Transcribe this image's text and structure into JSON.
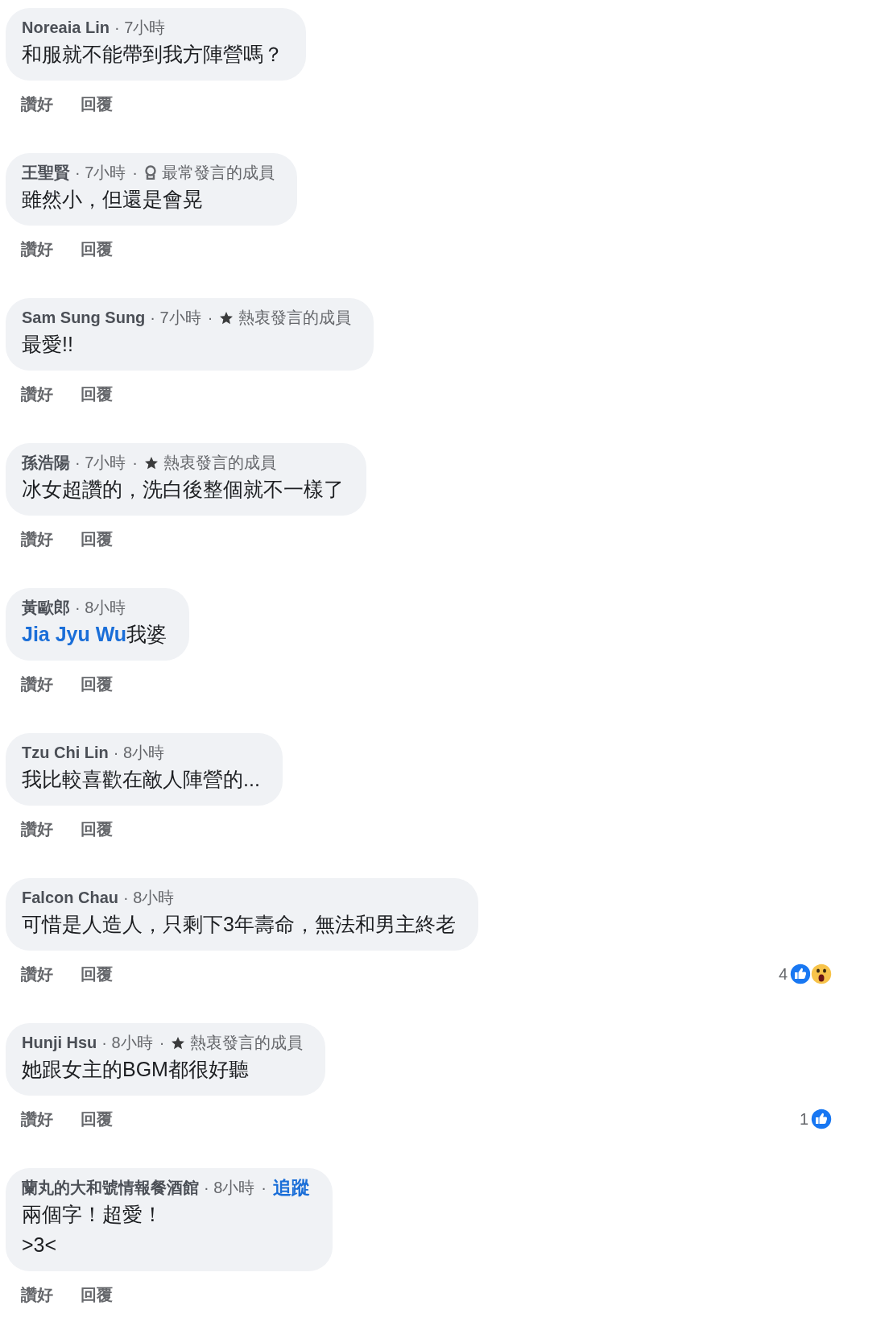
{
  "comments": [
    {
      "author": "Noreaia Lin",
      "time": "· 7小時",
      "body": [
        {
          "kind": "text",
          "text": "和服就不能帶到我方陣營嗎？"
        }
      ],
      "actions": [
        "讚好",
        "回覆"
      ]
    },
    {
      "author": "王聖賢",
      "time": "· 7小時",
      "separator": "·",
      "badge": {
        "kind": "top",
        "label": "最常發言的成員"
      },
      "body": [
        {
          "kind": "text",
          "text": "雖然小，但還是會晃"
        }
      ],
      "actions": [
        "讚好",
        "回覆"
      ]
    },
    {
      "author": "Sam Sung Sung",
      "time": "· 7小時",
      "separator": "·",
      "badge": {
        "kind": "star",
        "label": "熱衷發言的成員"
      },
      "body": [
        {
          "kind": "text",
          "text": "最愛!!"
        }
      ],
      "actions": [
        "讚好",
        "回覆"
      ]
    },
    {
      "author": "孫浩陽",
      "time": "· 7小時",
      "separator": "·",
      "badge": {
        "kind": "star",
        "label": "熱衷發言的成員"
      },
      "body": [
        {
          "kind": "text",
          "text": "冰女超讚的，洗白後整個就不一樣了"
        }
      ],
      "actions": [
        "讚好",
        "回覆"
      ]
    },
    {
      "author": "黃歐郎",
      "time": "· 8小時",
      "body": [
        {
          "kind": "mention",
          "text": "Jia Jyu Wu"
        },
        {
          "kind": "text",
          "text": "我婆"
        }
      ],
      "actions": [
        "讚好",
        "回覆"
      ]
    },
    {
      "author": "Tzu Chi Lin",
      "time": "· 8小時",
      "body": [
        {
          "kind": "text",
          "text": "我比較喜歡在敵人陣營的..."
        }
      ],
      "actions": [
        "讚好",
        "回覆"
      ]
    },
    {
      "author": "Falcon Chau",
      "time": "· 8小時",
      "body": [
        {
          "kind": "text",
          "text": "可惜是人造人，只剩下3年壽命，無法和男主終老"
        }
      ],
      "actions": [
        "讚好",
        "回覆"
      ],
      "reactions": {
        "count": "4",
        "icons": [
          {
            "kind": "like"
          },
          {
            "kind": "wow"
          }
        ]
      }
    },
    {
      "author": "Hunji Hsu",
      "time": "· 8小時",
      "separator": "·",
      "badge": {
        "kind": "star",
        "label": "熱衷發言的成員"
      },
      "body": [
        {
          "kind": "text",
          "text": "她跟女主的BGM都很好聽"
        }
      ],
      "actions": [
        "讚好",
        "回覆"
      ],
      "reactions": {
        "count": "1",
        "icons": [
          {
            "kind": "like"
          }
        ]
      }
    },
    {
      "author": "蘭丸的大和號情報餐酒館",
      "time": "· 8小時",
      "separator": "·",
      "follow": "追蹤",
      "body": [
        {
          "kind": "text",
          "text": "兩個字！超愛！\n>3<"
        }
      ],
      "actions": [
        "讚好",
        "回覆"
      ]
    }
  ]
}
